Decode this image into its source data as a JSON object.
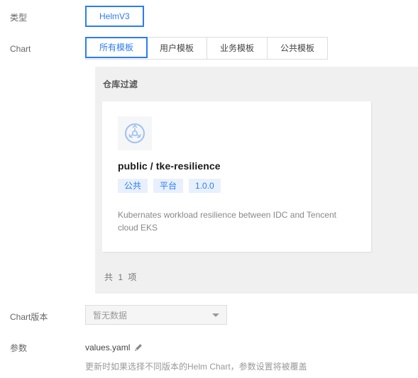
{
  "rows": {
    "type": {
      "label": "类型",
      "options": [
        {
          "label": "HelmV3",
          "selected": true
        }
      ]
    },
    "chart": {
      "label": "Chart",
      "tabs": [
        {
          "label": "所有模板",
          "active": true
        },
        {
          "label": "用户模板",
          "active": false
        },
        {
          "label": "业务模板",
          "active": false
        },
        {
          "label": "公共模板",
          "active": false
        }
      ]
    },
    "version": {
      "label": "Chart版本",
      "select_value": "暂无数据",
      "caret_icon": "chevron-down-icon"
    },
    "params": {
      "label": "参数",
      "file_name": "values.yaml",
      "edit_icon": "pencil-icon",
      "hint": "更新时如果选择不同版本的Helm Chart，参数设置将被覆盖"
    }
  },
  "repo_panel": {
    "title": "仓库过滤",
    "footer_prefix": "共",
    "footer_count": "1",
    "footer_suffix": "项",
    "card": {
      "icon": "helm-wheel-icon",
      "title": "public / tke-resilience",
      "tags": [
        "公共",
        "平台",
        "1.0.0"
      ],
      "description": "Kubernates workload resilience between IDC and Tencent cloud EKS"
    }
  },
  "colors": {
    "accent": "#2b7cf5",
    "tag_bg": "#e8f0fd",
    "panel_bg": "#f0f0f0",
    "label_text": "#666666",
    "muted_text": "#999999"
  }
}
